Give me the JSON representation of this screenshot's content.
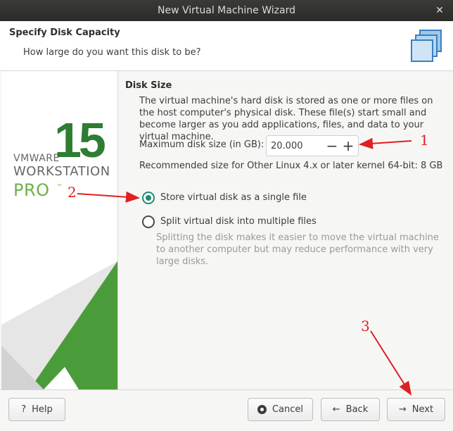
{
  "window": {
    "title": "New Virtual Machine Wizard",
    "close_glyph": "✕"
  },
  "header": {
    "title": "Specify Disk Capacity",
    "subtitle": "How large do you want this disk to be?",
    "icon": "wizard-stack-icon"
  },
  "branding": {
    "vmware": "VMWARE",
    "version": "15",
    "workstation": "WORKSTATION",
    "pro": "PRO",
    "tm": "™"
  },
  "disk": {
    "section_title": "Disk Size",
    "description": "The virtual machine's hard disk is stored as one or more files on the host computer's physical disk. These file(s) start small and become larger as you add applications, files, and data to your virtual machine.",
    "max_label": "Maximum disk size (in GB):",
    "max_value": "20.000",
    "minus_glyph": "−",
    "plus_glyph": "+",
    "recommended": "Recommended size for Other Linux 4.x or later kernel 64-bit: 8 GB"
  },
  "options": {
    "single_label": "Store virtual disk as a single file",
    "single_selected": true,
    "split_label": "Split virtual disk into multiple files",
    "split_selected": false,
    "split_description": "Splitting the disk makes it easier to move the virtual machine to another computer but may reduce performance with very large disks."
  },
  "buttons": {
    "help": "Help",
    "help_icon": "?",
    "cancel": "Cancel",
    "back": "Back",
    "back_icon": "←",
    "next": "Next",
    "next_icon": "→"
  },
  "annotations": {
    "label_1": "1",
    "label_2": "2",
    "label_3": "3",
    "color": "#e02020"
  }
}
